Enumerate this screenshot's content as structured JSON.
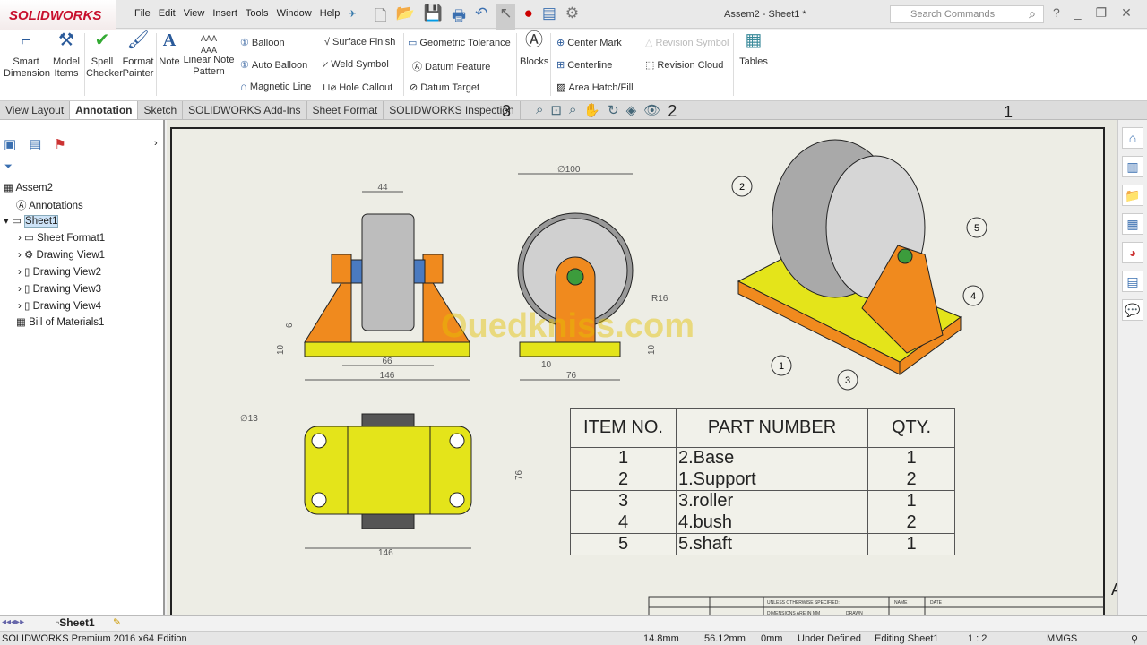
{
  "app": {
    "logo": "SOLIDWORKS",
    "title": "Assem2 - Sheet1 *",
    "search_placeholder": "Search Commands"
  },
  "menu": [
    "File",
    "Edit",
    "View",
    "Insert",
    "Tools",
    "Window",
    "Help"
  ],
  "ribbon": {
    "big": [
      {
        "label": "Smart Dimension",
        "icon": "smart-dimension-icon"
      },
      {
        "label": "Model Items",
        "icon": "model-items-icon"
      },
      {
        "label": "Spell Checker",
        "icon": "spell-checker-icon"
      },
      {
        "label": "Format Painter",
        "icon": "format-painter-icon"
      },
      {
        "label": "Note",
        "icon": "note-icon"
      },
      {
        "label": "Linear Note Pattern",
        "icon": "linear-note-pattern-icon"
      },
      {
        "label": "Blocks",
        "icon": "blocks-icon"
      },
      {
        "label": "Tables",
        "icon": "tables-icon"
      }
    ],
    "small": [
      "Balloon",
      "Auto Balloon",
      "Magnetic Line",
      "Surface Finish",
      "Weld Symbol",
      "Hole Callout",
      "Geometric Tolerance",
      "Datum Feature",
      "Datum Target",
      "Center Mark",
      "Centerline",
      "Area Hatch/Fill",
      "Revision Symbol",
      "Revision Cloud"
    ]
  },
  "tabs": [
    {
      "label": "View Layout"
    },
    {
      "label": "Annotation",
      "active": true
    },
    {
      "label": "Sketch"
    },
    {
      "label": "SOLIDWORKS Add-Ins"
    },
    {
      "label": "Sheet Format"
    },
    {
      "label": "SOLIDWORKS Inspection"
    }
  ],
  "overlay_numbers": [
    "3",
    "2",
    "1"
  ],
  "tree": [
    "Assem2",
    "Annotations",
    "Sheet1",
    "Sheet Format1",
    "Drawing View1",
    "Drawing View2",
    "Drawing View3",
    "Drawing View4",
    "Bill of Materials1"
  ],
  "drawing": {
    "dims": [
      "44",
      "6",
      "10",
      "66",
      "146",
      "∅100",
      "R16",
      "10",
      "76",
      "10",
      "∅13",
      "76",
      "146"
    ],
    "balloons": [
      "2",
      "5",
      "4",
      "1",
      "3"
    ],
    "zone_letter": "A",
    "watermark": "Ouedkniss.com",
    "title_block": [
      "UNLESS OTHERWISE SPECIFIED:",
      "NAME",
      "DATE",
      "DIMENSIONS ARE IN MM",
      "DRAWN"
    ]
  },
  "bom": {
    "headers": [
      "ITEM NO.",
      "PART NUMBER",
      "QTY."
    ],
    "rows": [
      [
        "1",
        "2.Base",
        "1"
      ],
      [
        "2",
        "1.Support",
        "2"
      ],
      [
        "3",
        "3.roller",
        "1"
      ],
      [
        "4",
        "4.bush",
        "2"
      ],
      [
        "5",
        "5.shaft",
        "1"
      ]
    ]
  },
  "sheet_tab": "Sheet1",
  "status": {
    "edition": "SOLIDWORKS Premium 2016 x64 Edition",
    "x": "14.8mm",
    "y": "56.12mm",
    "z": "0mm",
    "state": "Under Defined",
    "editing": "Editing Sheet1",
    "scale": "1 : 2",
    "units": "MMGS"
  },
  "colors": {
    "part_orange": "#f08a1e",
    "part_yellow": "#e4e41a",
    "roller_gray": "#b8b8b8",
    "brand": "#c8102e"
  }
}
